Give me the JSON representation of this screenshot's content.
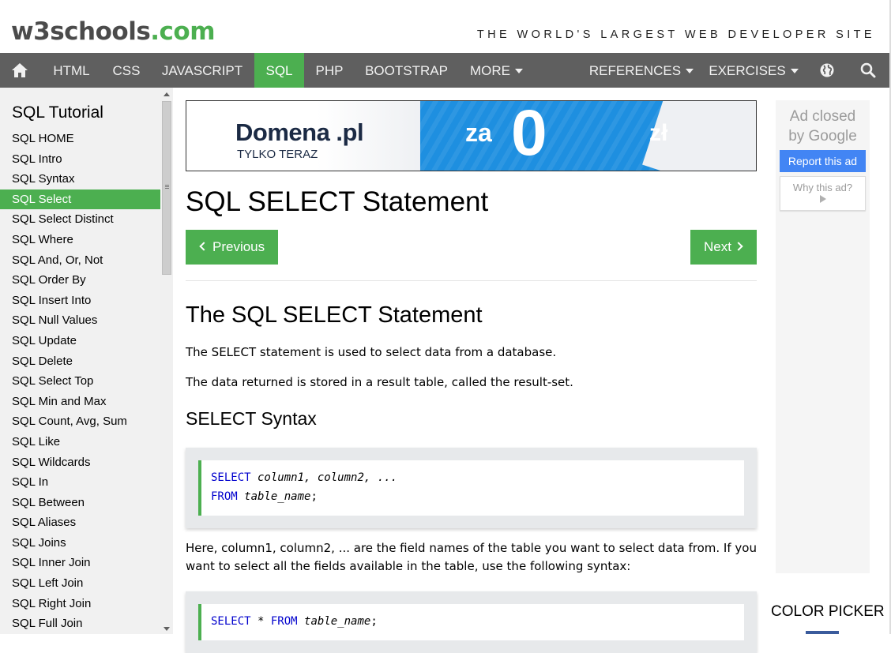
{
  "header": {
    "logo_part1": "w3schools",
    "logo_part2": ".com",
    "tagline": "THE WORLD'S LARGEST WEB DEVELOPER SITE"
  },
  "navbar": {
    "items": [
      "HTML",
      "CSS",
      "JAVASCRIPT",
      "SQL",
      "PHP",
      "BOOTSTRAP",
      "MORE",
      "REFERENCES",
      "EXERCISES"
    ],
    "active": "SQL",
    "accent": "#4CAF50",
    "bg": "#5f5f5f",
    "icons": [
      "home-icon",
      "globe-icon",
      "search-icon"
    ]
  },
  "sidebar": {
    "title": "SQL Tutorial",
    "items": [
      "SQL HOME",
      "SQL Intro",
      "SQL Syntax",
      "SQL Select",
      "SQL Select Distinct",
      "SQL Where",
      "SQL And, Or, Not",
      "SQL Order By",
      "SQL Insert Into",
      "SQL Null Values",
      "SQL Update",
      "SQL Delete",
      "SQL Select Top",
      "SQL Min and Max",
      "SQL Count, Avg, Sum",
      "SQL Like",
      "SQL Wildcards",
      "SQL In",
      "SQL Between",
      "SQL Aliases",
      "SQL Joins",
      "SQL Inner Join",
      "SQL Left Join",
      "SQL Right Join",
      "SQL Full Join"
    ],
    "active_index": 3
  },
  "banner": {
    "brand": "Domena .pl",
    "sub": "TYLKO TERAZ",
    "za": "za",
    "zero": "0",
    "zl": "zł"
  },
  "main": {
    "title": "SQL SELECT Statement",
    "prev_label": "Previous",
    "next_label": "Next",
    "section_title": "The SQL SELECT Statement",
    "p1": "The SELECT statement is used to select data from a database.",
    "p2": "The data returned is stored in a result table, called the result-set.",
    "syntax_title": "SELECT Syntax",
    "code1": {
      "l1_kw": "SELECT",
      "l1_rest": " column1, column2, ...",
      "l2_kw": "FROM",
      "l2_rest": " table_name",
      "l2_end": ";"
    },
    "p3": "Here, column1, column2, ... are the field names of the table you want to select data from. If you want to select all the fields available in the table, use the following syntax:",
    "code2": {
      "kw1": "SELECT",
      "star": " * ",
      "kw2": "FROM",
      "rest": " table_name",
      "end": ";"
    }
  },
  "ad": {
    "closed_line1": "Ad closed",
    "closed_line2": "by Google",
    "report": "Report this ad",
    "why": "Why this ad?"
  },
  "right_rail": {
    "color_picker": "COLOR PICKER"
  }
}
